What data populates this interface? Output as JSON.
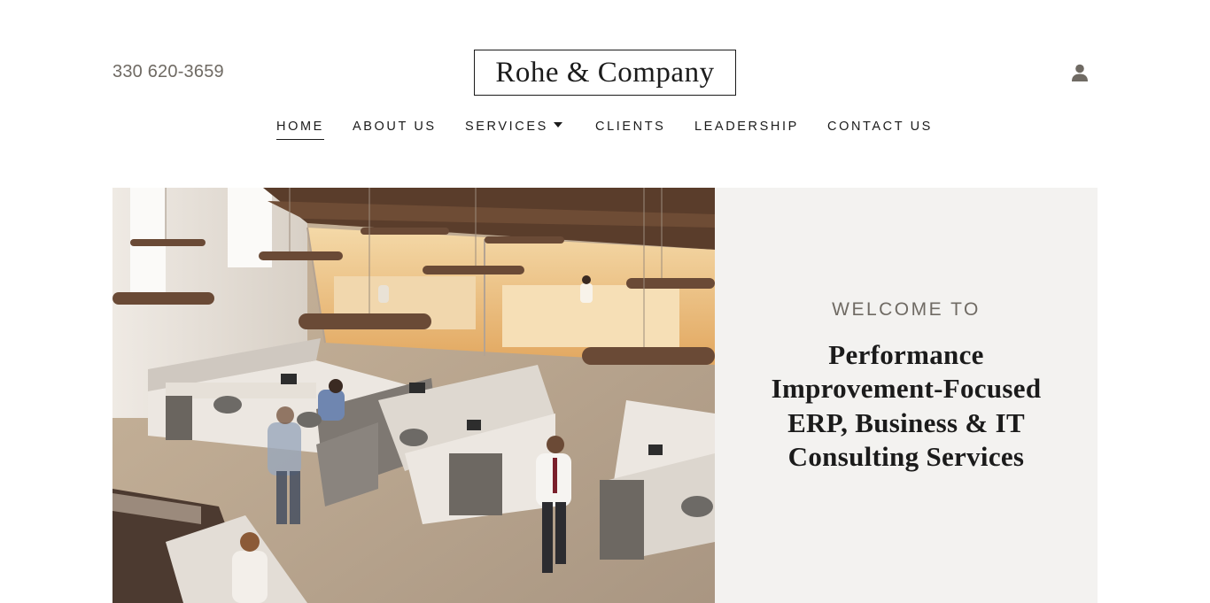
{
  "header": {
    "phone": "330 620-3659",
    "logo": "Rohe & Company"
  },
  "nav": {
    "items": [
      {
        "label": "HOME",
        "active": true
      },
      {
        "label": "ABOUT US",
        "active": false
      },
      {
        "label": "SERVICES",
        "active": false,
        "dropdown": true
      },
      {
        "label": "CLIENTS",
        "active": false
      },
      {
        "label": "LEADERSHIP",
        "active": false
      },
      {
        "label": "CONTACT US",
        "active": false
      }
    ]
  },
  "hero": {
    "welcome": "WELCOME TO",
    "headline": "Performance Improvement-Focused ERP, Business & IT Consulting Services",
    "image": "office-photo"
  },
  "colors": {
    "accent_gray": "#6f6a63",
    "panel_bg": "#f3f2f0",
    "text": "#1b1b1b"
  },
  "icons": {
    "account": "user-icon",
    "dropdown": "caret-down-icon"
  }
}
